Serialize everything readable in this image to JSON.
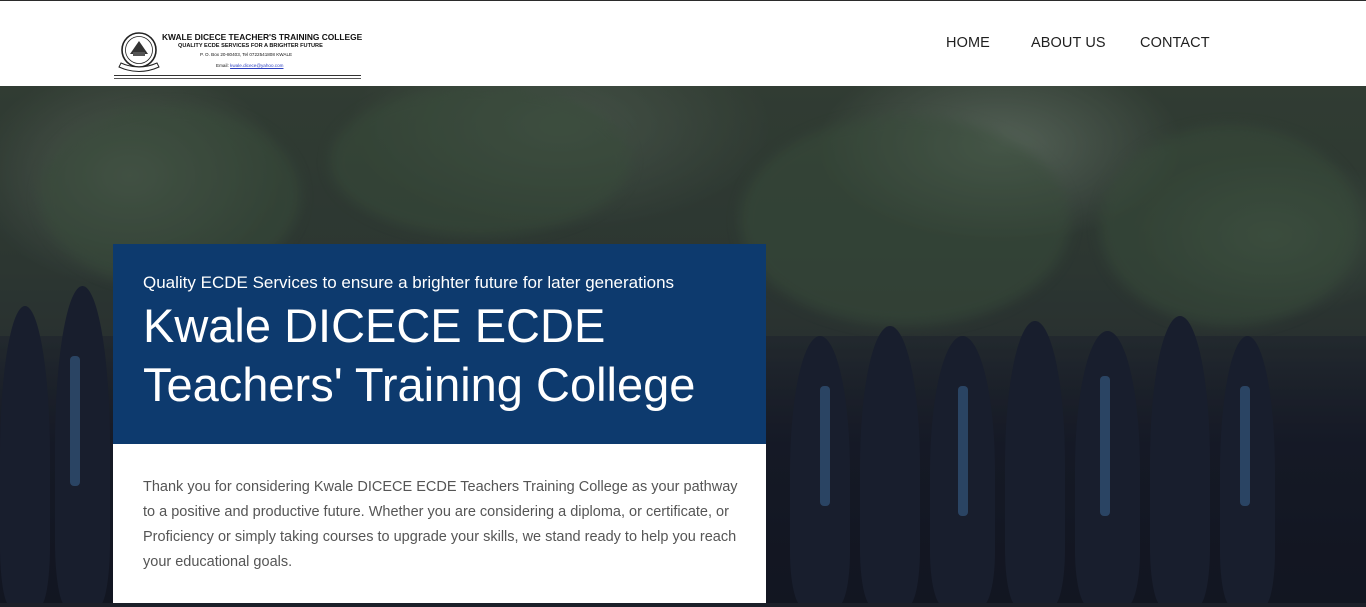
{
  "header": {
    "logo": {
      "name": "KWALE DICECE TEACHER'S TRAINING COLLEGE",
      "motto": "QUALITY ECDE SERVICES FOR A BRIGHTER FUTURE",
      "address": "P. O. Box 20-80403, Tel 0722541808 KWALE",
      "email_label": "Email:",
      "email": "kwale.dicece@yahoo.com"
    },
    "nav": [
      {
        "label": "HOME"
      },
      {
        "label": "ABOUT US"
      },
      {
        "label": "CONTACT"
      }
    ]
  },
  "hero": {
    "tagline": "Quality ECDE Services to ensure a brighter future for later generations",
    "title": "Kwale DICECE ECDE Teachers' Training College",
    "intro": "Thank you for considering Kwale DICECE ECDE Teachers Training College as your pathway to a positive and productive future. Whether you are considering a diploma, or certificate, or Proficiency or simply taking courses to upgrade your skills, we stand ready to help you reach your educational goals."
  },
  "colors": {
    "card_blue": "#0d3a6e",
    "nav_text": "#1f1f1f",
    "body_text": "#555555"
  }
}
